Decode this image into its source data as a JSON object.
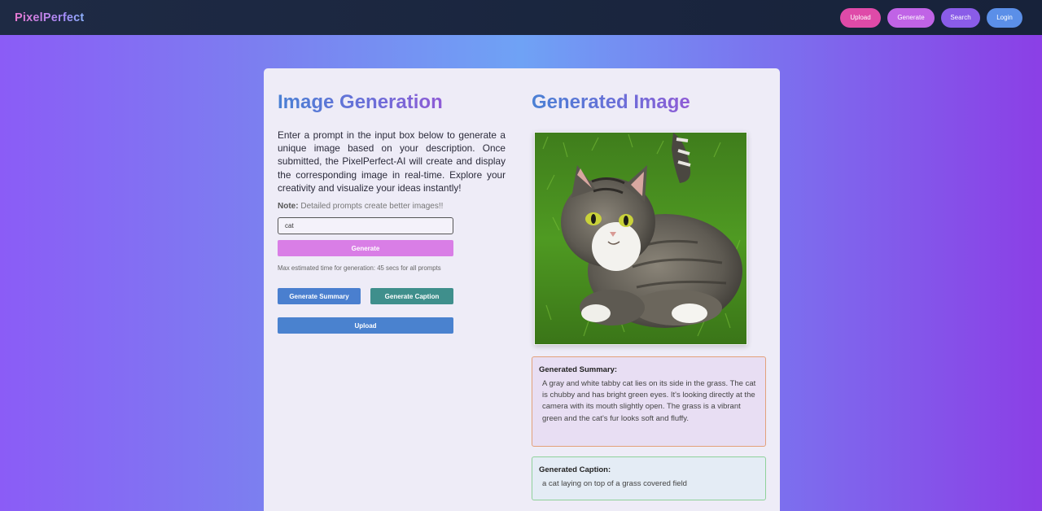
{
  "navbar": {
    "brand": "PixelPerfect",
    "buttons": [
      "Upload",
      "Generate",
      "Search",
      "Login"
    ]
  },
  "left": {
    "heading": "Image Generation",
    "description": "Enter a prompt in the input box below to generate a unique image based on your description. Once submitted, the PixelPerfect-AI will create and display the corresponding image in real-time. Explore your creativity and visualize your ideas instantly!",
    "note_label": "Note:",
    "note_text": "Detailed prompts create better images!!",
    "prompt_value": "cat",
    "generate_label": "Generate",
    "max_time": "Max estimated time for generation: 45 secs for all prompts",
    "summary_button": "Generate Summary",
    "caption_button": "Generate Caption",
    "upload_button": "Upload"
  },
  "right": {
    "heading": "Generated Image",
    "summary_title": "Generated Summary:",
    "summary_text": "A gray and white tabby cat lies on its side in the grass. The cat is chubby and has bright green eyes. It's looking directly at the camera with its mouth slightly open. The grass is a vibrant green and the cat's fur looks soft and fluffy.",
    "caption_title": "Generated Caption:",
    "caption_text": "a cat laying on top of a grass covered field"
  },
  "colors": {
    "nav_bg": "#1e2a44",
    "upload": "#df4aa8",
    "generate": "#c063e6",
    "search": "#8a5ce8",
    "login": "#5b8fe8",
    "accent_blue": "#4a7fcf",
    "accent_teal": "#3f8f8c"
  }
}
